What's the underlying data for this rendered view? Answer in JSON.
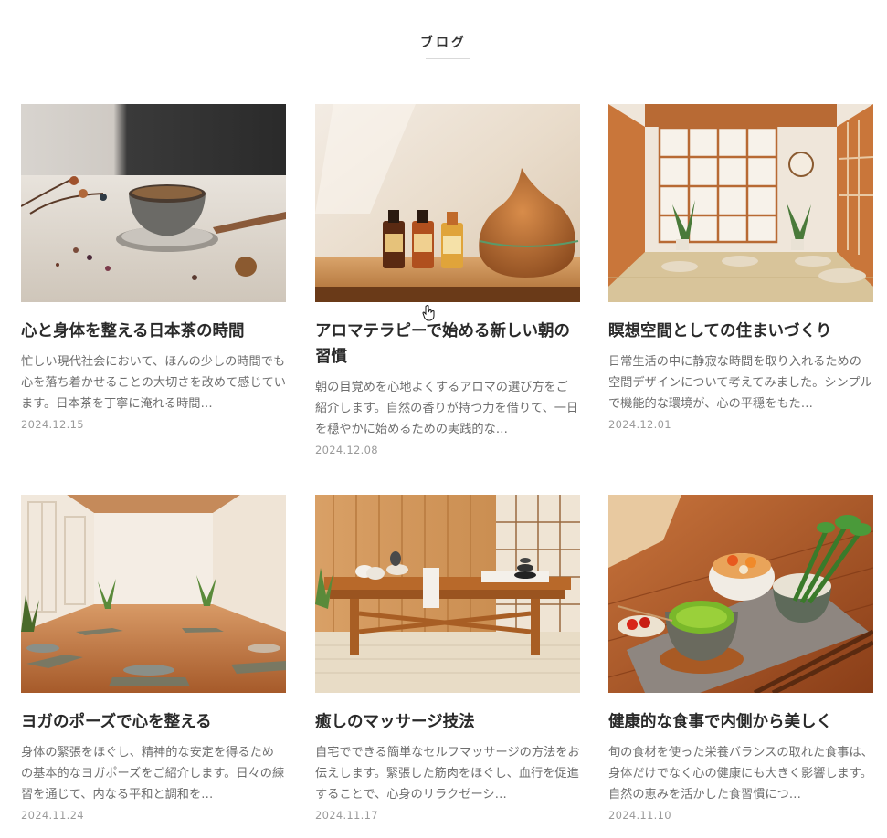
{
  "header": {
    "title": "ブログ"
  },
  "posts": [
    {
      "title": "心と身体を整える日本茶の時間",
      "excerpt": "忙しい現代社会において、ほんの少しの時間でも心を落ち着かせることの大切さを改めて感じています。日本茶を丁寧に淹れる時間…",
      "date": "2024.12.15",
      "image": "japanese-tea-cup-photo"
    },
    {
      "title": "アロマテラピーで始める新しい朝の習慣",
      "excerpt": "朝の目覚めを心地よくするアロマの選び方をご紹介します。自然の香りが持つ力を借りて、一日を穏やかに始めるための実践的な…",
      "date": "2024.12.08",
      "image": "aroma-bottles-diffuser-photo"
    },
    {
      "title": "瞑想空間としての住まいづくり",
      "excerpt": "日常生活の中に静寂な時間を取り入れるための空間デザインについて考えてみました。シンプルで機能的な環境が、心の平穏をもた…",
      "date": "2024.12.01",
      "image": "japanese-meditation-room-photo"
    },
    {
      "title": "ヨガのポーズで心を整える",
      "excerpt": "身体の緊張をほぐし、精神的な安定を得るための基本的なヨガポーズをご紹介します。日々の練習を通じて、内なる平和と調和を…",
      "date": "2024.11.24",
      "image": "yoga-studio-photo"
    },
    {
      "title": "癒しのマッサージ技法",
      "excerpt": "自宅でできる簡単なセルフマッサージの方法をお伝えします。緊張した筋肉をほぐし、血行を促進することで、心身のリラクゼーシ…",
      "date": "2024.11.17",
      "image": "massage-table-photo"
    },
    {
      "title": "健康的な食事で内側から美しく",
      "excerpt": "旬の食材を使った栄養バランスの取れた食事は、身体だけでなく心の健康にも大きく影響します。自然の恵みを活かした食習慣につ…",
      "date": "2024.11.10",
      "image": "healthy-meal-matcha-photo"
    }
  ]
}
